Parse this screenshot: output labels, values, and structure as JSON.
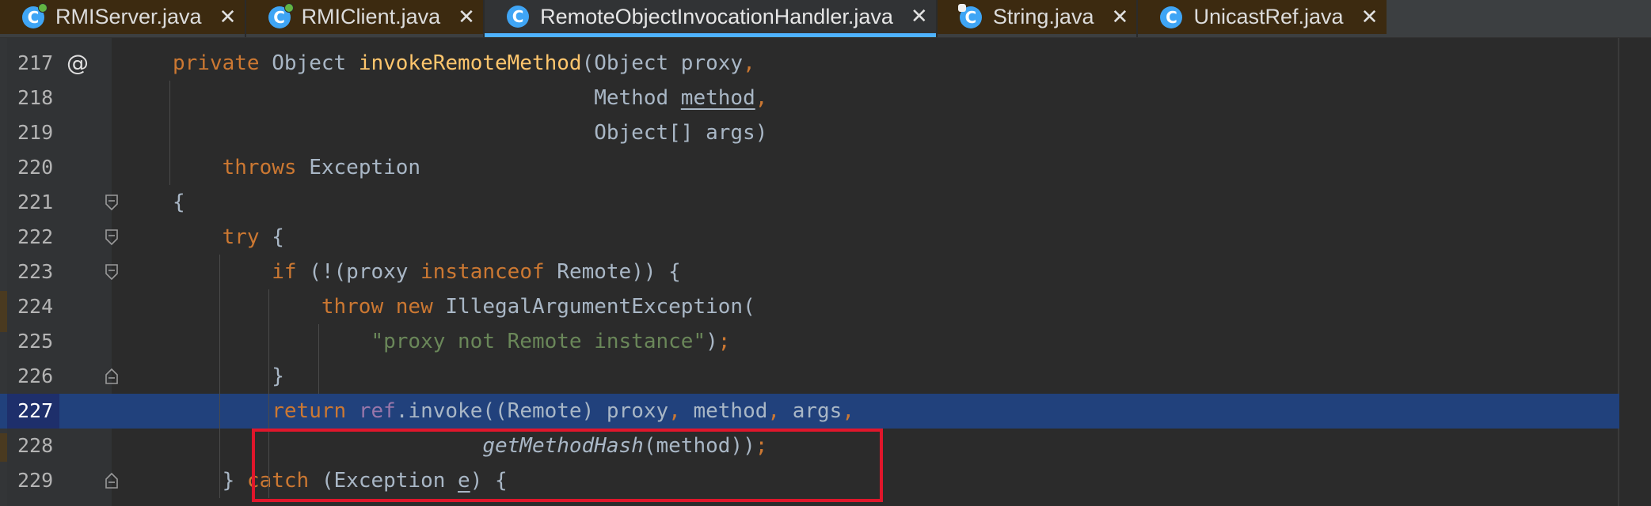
{
  "tabs": [
    {
      "label": "RMIServer.java",
      "icon": "java-class-run-icon",
      "active": false
    },
    {
      "label": "RMIClient.java",
      "icon": "java-class-run-icon",
      "active": false
    },
    {
      "label": "RemoteObjectInvocationHandler.java",
      "icon": "java-class-icon",
      "active": true
    },
    {
      "label": "String.java",
      "icon": "java-class-locked-icon",
      "active": false
    },
    {
      "label": "UnicastRef.java",
      "icon": "java-class-icon",
      "active": false
    }
  ],
  "tab_icon_letter": "C",
  "close_glyph": "✕",
  "gutter_marker_217": "@",
  "current_line": "227",
  "colors": {
    "keyword": "#cc7832",
    "method_decl": "#ffc66d",
    "string": "#6a8759",
    "field": "#9876aa",
    "plain": "#a9b7c6",
    "current_line_bg": "#21417c",
    "highlight_box": "#e0162b",
    "active_tab_underline": "#4fb3ff"
  },
  "lines": [
    {
      "number": "217",
      "tokens": [
        [
          "kw",
          "private"
        ],
        [
          "pl",
          " Object "
        ],
        [
          "fn",
          "invokeRemoteMethod"
        ],
        [
          "pl",
          "(Object proxy"
        ],
        [
          "kw",
          ","
        ]
      ]
    },
    {
      "number": "218",
      "tokens": [
        [
          "pl",
          "                                  Method "
        ],
        [
          "ul",
          "method"
        ],
        [
          "kw",
          ","
        ]
      ]
    },
    {
      "number": "219",
      "tokens": [
        [
          "pl",
          "                                  Object[] args)"
        ]
      ]
    },
    {
      "number": "220",
      "tokens": [
        [
          "pl",
          "    "
        ],
        [
          "kw",
          "throws"
        ],
        [
          "pl",
          " Exception"
        ]
      ]
    },
    {
      "number": "221",
      "tokens": [
        [
          "pl",
          "{"
        ]
      ]
    },
    {
      "number": "222",
      "tokens": [
        [
          "pl",
          "    "
        ],
        [
          "kw",
          "try"
        ],
        [
          "pl",
          " {"
        ]
      ]
    },
    {
      "number": "223",
      "tokens": [
        [
          "pl",
          "        "
        ],
        [
          "kw",
          "if"
        ],
        [
          "pl",
          " (!(proxy "
        ],
        [
          "kw",
          "instanceof"
        ],
        [
          "pl",
          " Remote)) {"
        ]
      ]
    },
    {
      "number": "224",
      "tokens": [
        [
          "pl",
          "            "
        ],
        [
          "kw",
          "throw new"
        ],
        [
          "pl",
          " IllegalArgumentException("
        ]
      ]
    },
    {
      "number": "225",
      "tokens": [
        [
          "pl",
          "                "
        ],
        [
          "str",
          "\"proxy not Remote instance\""
        ],
        [
          "pl",
          ")"
        ],
        [
          "kw",
          ";"
        ]
      ]
    },
    {
      "number": "226",
      "tokens": [
        [
          "pl",
          "        }"
        ]
      ]
    },
    {
      "number": "227",
      "tokens": [
        [
          "pl",
          "        "
        ],
        [
          "kw",
          "return"
        ],
        [
          "pl",
          " "
        ],
        [
          "field",
          "ref"
        ],
        [
          "pl",
          ".invoke((Remote) proxy"
        ],
        [
          "kw",
          ","
        ],
        [
          "pl",
          " method"
        ],
        [
          "kw",
          ","
        ],
        [
          "pl",
          " args"
        ],
        [
          "kw",
          ","
        ]
      ]
    },
    {
      "number": "228",
      "tokens": [
        [
          "pl",
          "                         "
        ],
        [
          "it",
          "getMethodHash"
        ],
        [
          "pl",
          "(method))"
        ],
        [
          "kw",
          ";"
        ]
      ]
    },
    {
      "number": "229",
      "tokens": [
        [
          "pl",
          "    } "
        ],
        [
          "kw",
          "catch"
        ],
        [
          "pl",
          " (Exception "
        ],
        [
          "ul",
          "e"
        ],
        [
          "pl",
          ") {"
        ]
      ]
    }
  ]
}
